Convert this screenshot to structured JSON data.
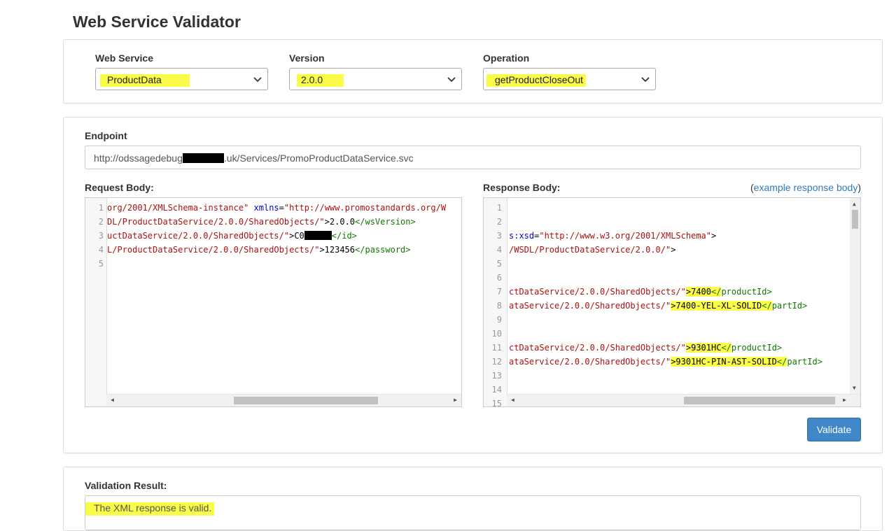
{
  "page_title": "Web Service Validator",
  "selectors": {
    "web_service": {
      "label": "Web Service",
      "value": "ProductData"
    },
    "version": {
      "label": "Version",
      "value": "2.0.0"
    },
    "operation": {
      "label": "Operation",
      "value": "getProductCloseOut"
    }
  },
  "endpoint": {
    "label": "Endpoint",
    "value_prefix": "http://odssagedebug",
    "value_suffix": ".uk/Services/PromoProductDataService.svc"
  },
  "request": {
    "label": "Request Body:",
    "line_numbers": [
      "1",
      "2",
      "3",
      "4",
      "5"
    ],
    "lines": [
      [
        {
          "t": "org/2001/XMLSchema-instance\"",
          "c": "str"
        },
        {
          "t": " ",
          "c": "plain"
        },
        {
          "t": "xmlns",
          "c": "attr"
        },
        {
          "t": "=",
          "c": "plain"
        },
        {
          "t": "\"http://www.promostandards.org/W",
          "c": "str"
        }
      ],
      [
        {
          "t": "DL/ProductDataService/2.0.0/SharedObjects/\"",
          "c": "str"
        },
        {
          "t": ">2.0.0",
          "c": "plain"
        },
        {
          "t": "</wsVersion>",
          "c": "tag"
        }
      ],
      [
        {
          "t": "uctDataService/2.0.0/SharedObjects/\"",
          "c": "str"
        },
        {
          "t": ">C0",
          "c": "plain"
        }
      ],
      [
        {
          "t": "L/ProductDataService/2.0.0/SharedObjects/\"",
          "c": "str"
        },
        {
          "t": ">123456",
          "c": "plain"
        },
        {
          "t": "</password>",
          "c": "tag"
        }
      ],
      []
    ],
    "line3_tail": "</id>"
  },
  "response": {
    "label": "Response Body:",
    "example_link_open": "(",
    "example_link": "example response body",
    "example_link_close": ")",
    "line_numbers": [
      "1",
      "2",
      "3",
      "4",
      "5",
      "6",
      "7",
      "8",
      "9",
      "10",
      "11",
      "12",
      "13",
      "14",
      "15"
    ],
    "lines": [
      [],
      [],
      [
        {
          "t": "s:xsd",
          "c": "attr"
        },
        {
          "t": "=",
          "c": "plain"
        },
        {
          "t": "\"http://www.w3.org/2001/XMLSchema\"",
          "c": "str"
        },
        {
          "t": ">",
          "c": "plain"
        }
      ],
      [
        {
          "t": "/WSDL/ProductDataService/2.0.0/\"",
          "c": "str"
        },
        {
          "t": ">",
          "c": "plain"
        }
      ],
      [],
      [],
      [
        {
          "t": "ctDataService/2.0.0/SharedObjects/\"",
          "c": "str"
        },
        {
          "t": ">7400",
          "c": "plain",
          "hl": true
        },
        {
          "t": "</",
          "c": "tag",
          "hl": true
        },
        {
          "t": "productId>",
          "c": "tag"
        }
      ],
      [
        {
          "t": "ataService/2.0.0/SharedObjects/\"",
          "c": "str"
        },
        {
          "t": ">7400-YEL-XL-SOLID",
          "c": "plain",
          "hl": true
        },
        {
          "t": "</",
          "c": "tag",
          "hl": true
        },
        {
          "t": "partId>",
          "c": "tag"
        }
      ],
      [],
      [],
      [
        {
          "t": "ctDataService/2.0.0/SharedObjects/\"",
          "c": "str"
        },
        {
          "t": ">9301HC",
          "c": "plain",
          "hl": true
        },
        {
          "t": "</",
          "c": "tag",
          "hl": true
        },
        {
          "t": "productId>",
          "c": "tag"
        }
      ],
      [
        {
          "t": "ataService/2.0.0/SharedObjects/\"",
          "c": "str"
        },
        {
          "t": ">9301HC-PIN-AST-SOLID",
          "c": "plain",
          "hl": true
        },
        {
          "t": "</",
          "c": "tag",
          "hl": true
        },
        {
          "t": "partId>",
          "c": "tag"
        }
      ],
      [],
      [],
      []
    ]
  },
  "validate_button": "Validate",
  "validation": {
    "label": "Validation Result:",
    "message": "The XML response is valid."
  },
  "colors": {
    "highlight": "#fbfb4a",
    "button": "#3f87c8",
    "link": "#337ab7",
    "xml_string": "#aa1111",
    "xml_attr": "#0000cc",
    "xml_tag": "#117700"
  }
}
